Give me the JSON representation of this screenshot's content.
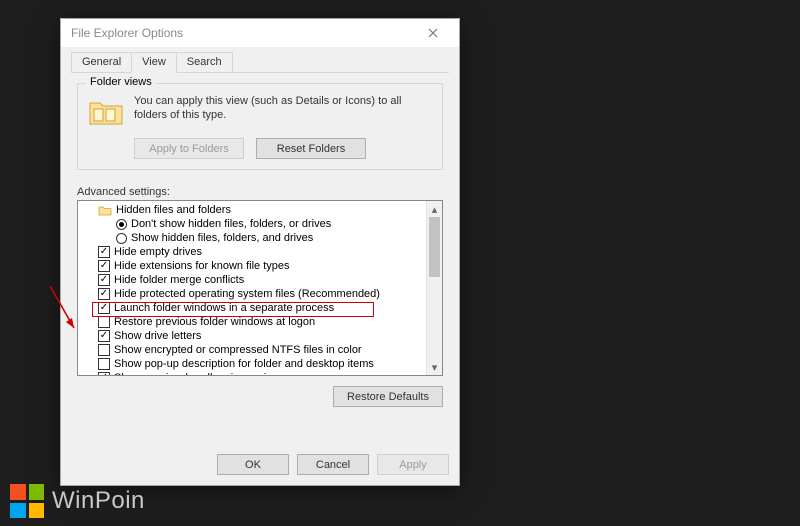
{
  "window": {
    "title": "File Explorer Options"
  },
  "tabs": {
    "general": "General",
    "view": "View",
    "search": "Search"
  },
  "folder_views": {
    "group_label": "Folder views",
    "description": "You can apply this view (such as Details or Icons) to all folders of this type.",
    "apply_btn": "Apply to Folders",
    "reset_btn": "Reset Folders"
  },
  "advanced": {
    "label": "Advanced settings:",
    "items": [
      {
        "type": "folder",
        "text": "Hidden files and folders",
        "indent": 1
      },
      {
        "type": "radio",
        "selected": true,
        "text": "Don't show hidden files, folders, or drives",
        "indent": 2
      },
      {
        "type": "radio",
        "selected": false,
        "text": "Show hidden files, folders, and drives",
        "indent": 2
      },
      {
        "type": "check",
        "checked": true,
        "text": "Hide empty drives",
        "indent": 1
      },
      {
        "type": "check",
        "checked": true,
        "text": "Hide extensions for known file types",
        "indent": 1
      },
      {
        "type": "check",
        "checked": true,
        "text": "Hide folder merge conflicts",
        "indent": 1
      },
      {
        "type": "check",
        "checked": true,
        "text": "Hide protected operating system files (Recommended)",
        "indent": 1
      },
      {
        "type": "check",
        "checked": true,
        "text": "Launch folder windows in a separate process",
        "indent": 1,
        "highlight": true
      },
      {
        "type": "check",
        "checked": false,
        "text": "Restore previous folder windows at logon",
        "indent": 1
      },
      {
        "type": "check",
        "checked": true,
        "text": "Show drive letters",
        "indent": 1
      },
      {
        "type": "check",
        "checked": false,
        "text": "Show encrypted or compressed NTFS files in color",
        "indent": 1
      },
      {
        "type": "check",
        "checked": false,
        "text": "Show pop-up description for folder and desktop items",
        "indent": 1
      },
      {
        "type": "check",
        "checked": true,
        "text": "Show preview handlers in preview pane",
        "indent": 1
      }
    ]
  },
  "buttons": {
    "restore_defaults": "Restore Defaults",
    "ok": "OK",
    "cancel": "Cancel",
    "apply": "Apply"
  },
  "brand": "WinPoin"
}
